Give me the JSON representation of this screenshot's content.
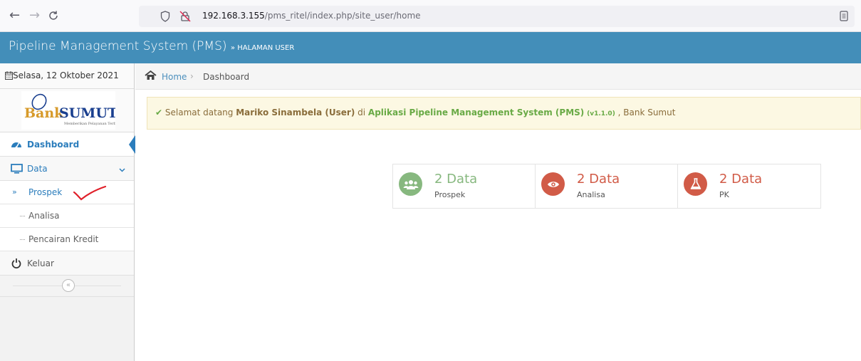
{
  "browser": {
    "back": "←",
    "forward": "→",
    "reload": "C",
    "url_host": "192.168.3.155",
    "url_path": "/pms_ritel/index.php/site_user/home"
  },
  "header": {
    "title": "Pipeline Management System (PMS)",
    "subtitle": "» HALAMAN USER",
    "color": "#438eb9"
  },
  "sidebar": {
    "date": "Selasa, 12 Oktober 2021",
    "logo": {
      "brand": "BankSUMUT",
      "tagline": "Memberikan Pelayanan Terbaik"
    },
    "items": [
      {
        "label": "Dashboard",
        "icon": "tachometer-icon"
      },
      {
        "label": "Data",
        "icon": "desktop-icon"
      }
    ],
    "subitems": [
      {
        "label": "Prospek"
      },
      {
        "label": "Analisa"
      },
      {
        "label": "Pencairan Kredit"
      }
    ],
    "logout": {
      "label": "Keluar",
      "icon": "power-icon"
    },
    "collapse": "«"
  },
  "breadcrumb": {
    "home": "Home",
    "separator": "›",
    "current": "Dashboard"
  },
  "alert": {
    "check": "✔",
    "prefix": "Selamat datang ",
    "user": "Mariko Sinambela (User)",
    "middle": " di ",
    "app": "Aplikasi Pipeline Management System (PMS)",
    "version": "(v1.1.0)",
    "suffix": " , Bank Sumut"
  },
  "stats": [
    {
      "value": "2 Data",
      "label": "Prospek",
      "color": "#87b87f",
      "icon": "users-icon"
    },
    {
      "value": "2 Data",
      "label": "Analisa",
      "color": "#d15b47",
      "icon": "eye-icon"
    },
    {
      "value": "2 Data",
      "label": "PK",
      "color": "#d15b47",
      "icon": "flask-icon"
    }
  ]
}
